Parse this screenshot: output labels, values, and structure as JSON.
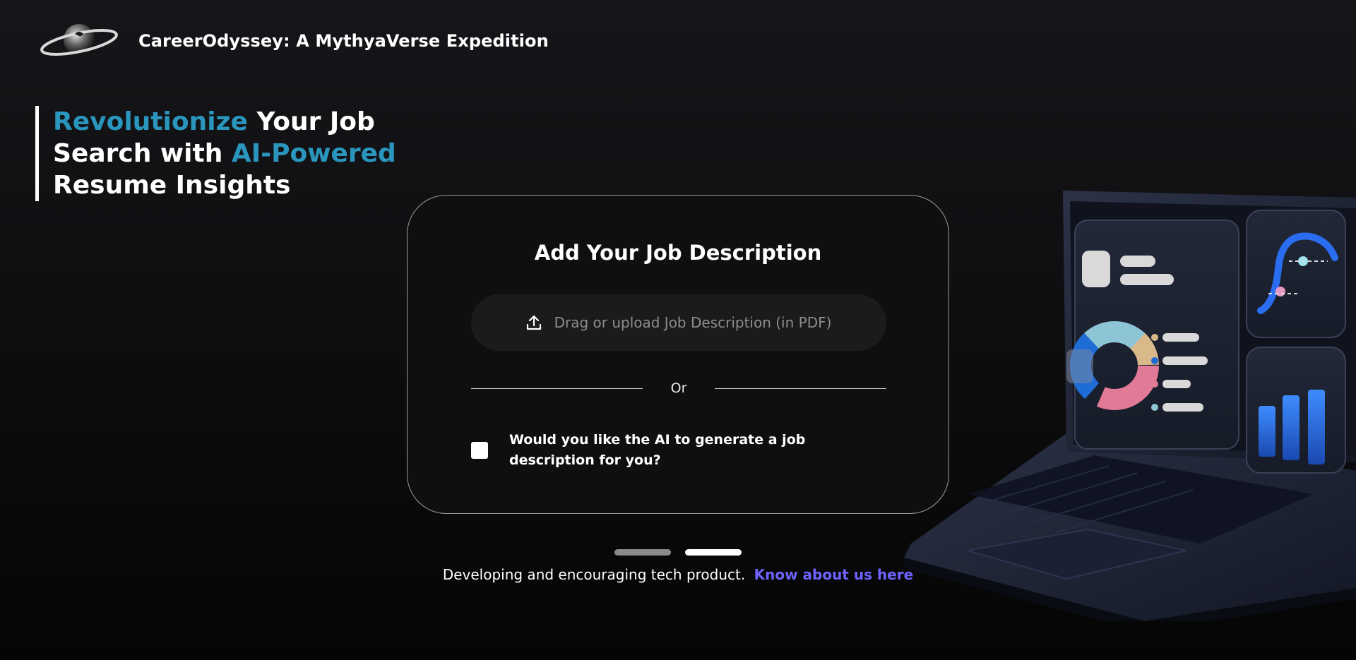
{
  "header": {
    "app_title": "CareerOdyssey: A MythyaVerse Expedition",
    "logo_icon": "planet-logo-icon"
  },
  "hero": {
    "word1": "Revolutionize",
    "word2": " Your Job",
    "word3": "Search with ",
    "word4": "AI-Powered",
    "word5": "Resume Insights",
    "accent_color": "#2a96bd"
  },
  "card": {
    "title": "Add Your Job Description",
    "upload_placeholder": "Drag or upload Job Description (in PDF)",
    "upload_icon": "upload-icon",
    "or_text": "Or",
    "checkbox_label": "Would you like the AI to generate a job description for you?",
    "checkbox_checked": false
  },
  "pager": {
    "count": 2,
    "active_index": 1
  },
  "footer": {
    "text": "Developing and encouraging tech product.",
    "link_text": "Know about us here",
    "link_color": "#6f63ff"
  },
  "illustration": {
    "icon": "laptop-dashboard-illustration"
  }
}
